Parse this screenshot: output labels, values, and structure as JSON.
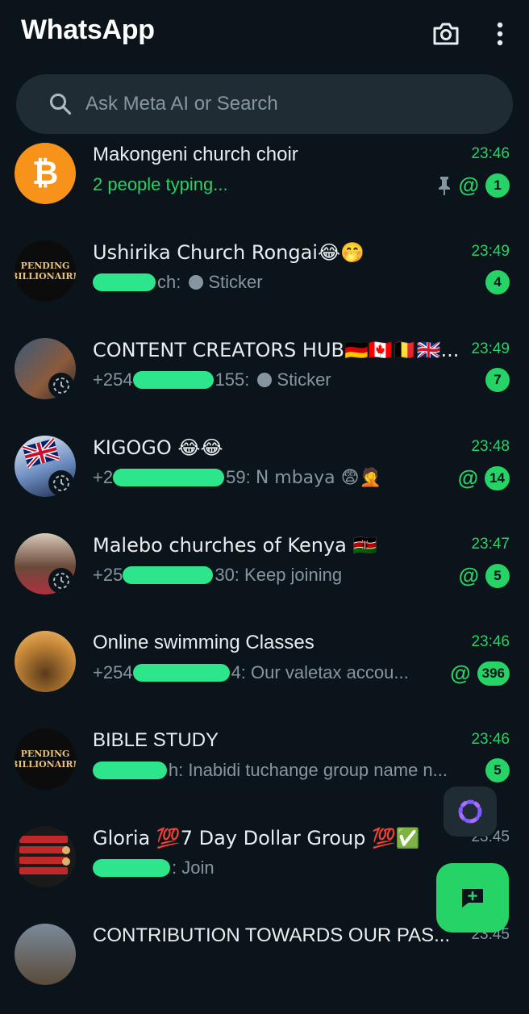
{
  "header": {
    "title": "WhatsApp",
    "camera_icon": "camera-icon",
    "menu_icon": "more-vert-icon"
  },
  "search": {
    "placeholder": "Ask Meta AI or Search"
  },
  "colors": {
    "accent": "#25d366",
    "background": "#0b141a",
    "search_bg": "#202c33",
    "muted": "#8696a0"
  },
  "chats": [
    {
      "name": "Makongeni church choir",
      "time": "23:46",
      "preview": "2 people typing...",
      "pinned": true,
      "mention": true,
      "unread": "1",
      "avatar": "bitcoin"
    },
    {
      "name": "Ushirika Church Rongai😂🤭",
      "time": "23:49",
      "preview_sender": "ch:",
      "preview": "Sticker",
      "unread": "4",
      "avatar": "pending-billionaire"
    },
    {
      "name": "CONTENT CREATORS HUB🇩🇪🇨🇦🇧🇪🇬🇧...",
      "time": "23:49",
      "preview_sender_start": "+254",
      "preview_sender": "155:",
      "preview": "Sticker",
      "unread": "7",
      "avatar": "photo"
    },
    {
      "name": "KIGOGO 😂😂",
      "time": "23:48",
      "preview_sender_start": "+2",
      "preview_sender": "59:",
      "preview": "N mbaya 😨🤦",
      "mention": true,
      "unread": "14",
      "avatar": "flag"
    },
    {
      "name": "Malebo churches of Kenya 🇰🇪",
      "time": "23:47",
      "preview_sender_start": "+25",
      "preview_sender": "30:",
      "preview": "Keep joining",
      "mention": true,
      "unread": "5",
      "avatar": "photo"
    },
    {
      "name": "Online swimming Classes",
      "time": "23:46",
      "preview_sender_start": "+254",
      "preview_sender": "4:",
      "preview": "Our valetax accou...",
      "mention": true,
      "unread": "396",
      "avatar": "lion"
    },
    {
      "name": "BIBLE STUDY",
      "time": "23:46",
      "preview_sender": "h:",
      "preview": "Inabidi tuchange group name n...",
      "unread": "5",
      "avatar": "pending-billionaire"
    },
    {
      "name": "Gloria 💯7 Day Dollar Group 💯✅",
      "time": "23:45",
      "preview_sender": ":",
      "preview": "Join",
      "avatar": "menu"
    },
    {
      "name": "CONTRIBUTION TOWARDS OUR PAS...",
      "time": "23:45",
      "avatar": "photo"
    }
  ],
  "avatar_text": {
    "pending": "PENDING",
    "billionaire": "BILLIONAIRE"
  },
  "fab": {
    "meta_ai_icon": "meta-ai-icon",
    "new_chat_icon": "new-chat-icon"
  }
}
